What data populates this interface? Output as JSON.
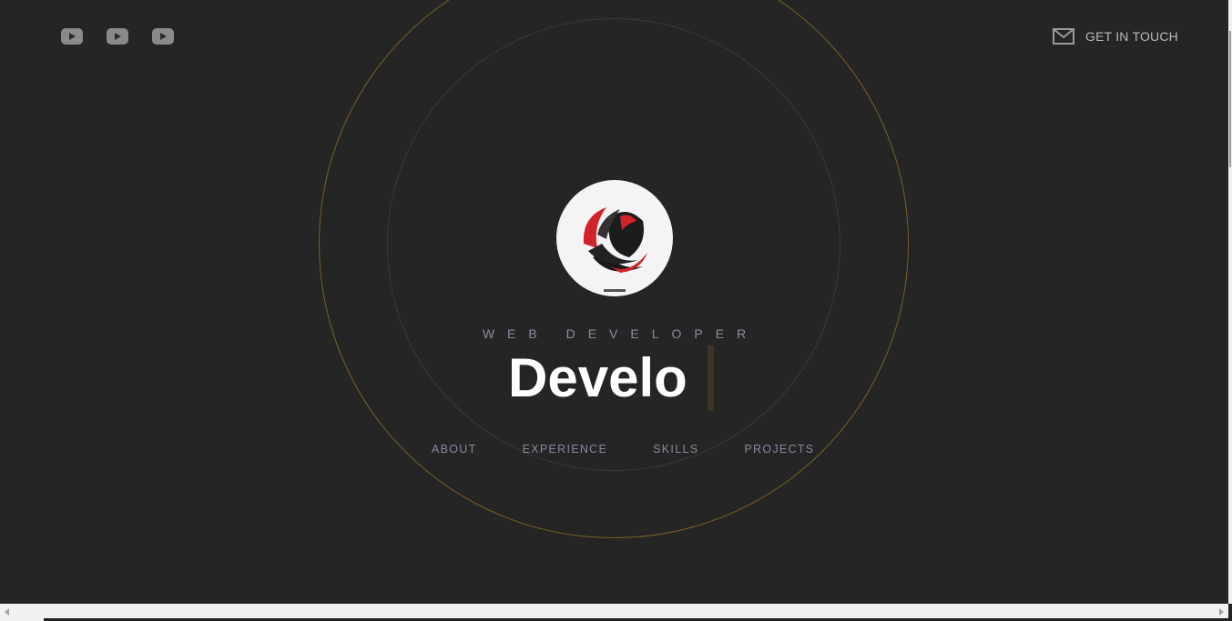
{
  "header": {
    "social_icons": [
      "youtube-icon",
      "youtube-icon",
      "youtube-icon"
    ],
    "contact": {
      "icon": "mail-icon",
      "label": "GET IN TOUCH"
    }
  },
  "hero": {
    "avatar_icon": "lion-logo",
    "role": "WEB DEVELOPER",
    "headline": "Develo"
  },
  "nav": {
    "items": [
      {
        "label": "ABOUT"
      },
      {
        "label": "EXPERIENCE"
      },
      {
        "label": "SKILLS"
      },
      {
        "label": "PROJECTS"
      }
    ]
  },
  "colors": {
    "background": "#252525",
    "accent_ring": "#7a5f25",
    "nav_text": "#8b87a0",
    "headline": "#ffffff"
  }
}
